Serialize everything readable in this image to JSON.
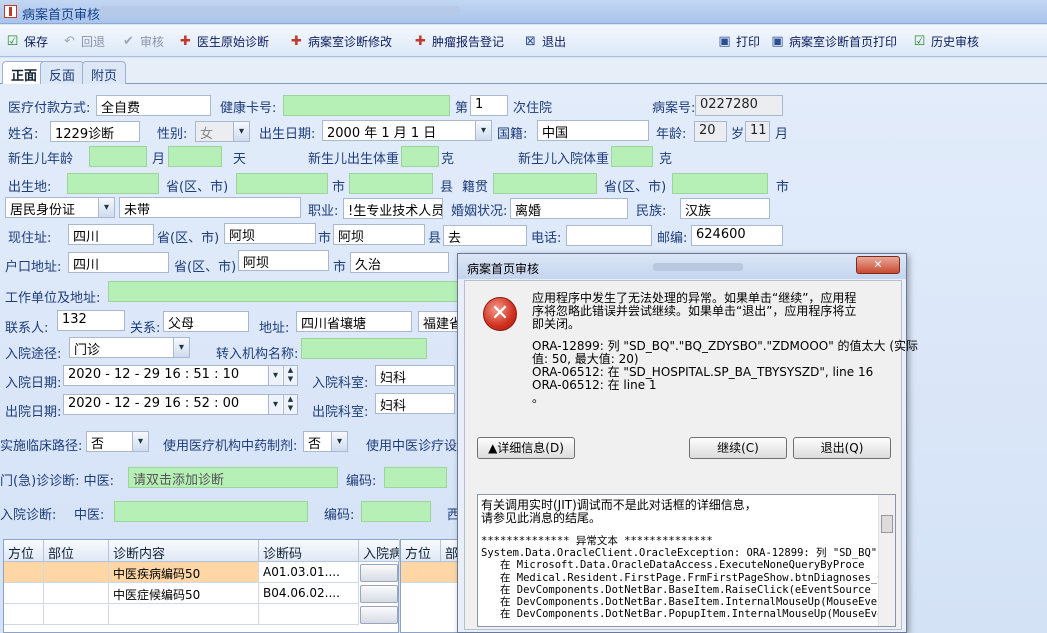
{
  "window": {
    "title": "病案首页审核"
  },
  "toolbar": {
    "save": "保存",
    "rollback": "回退",
    "review": "审核",
    "doctor_diag": "医生原始诊断",
    "room_diag_edit": "病案室诊断修改",
    "tumor_report": "肿瘤报告登记",
    "exit": "退出",
    "print": "打印",
    "room_print": "病案室诊断首页打印",
    "history": "历史审核"
  },
  "tabs": [
    "正面",
    "反面",
    "附页"
  ],
  "form": {
    "pay_label": "医疗付款方式:",
    "pay_value": "全自费",
    "health_card_label": "健康卡号:",
    "health_card_value": "",
    "visit_prefix": "第",
    "visit_value": "1",
    "visit_suffix": "次住院",
    "case_no_label": "病案号:",
    "case_no_value": "0227280",
    "name_label": "姓名:",
    "name_value": "1229诊断",
    "gender_label": "性别:",
    "gender_value": "女",
    "dob_label": "出生日期:",
    "dob_value": "2000 年 1 月 1 日",
    "nationality_label": "国籍:",
    "nationality_value": "中国",
    "age_label": "年龄:",
    "age_value": "20",
    "age_unit": "岁",
    "age_month": "11",
    "month_unit": "月",
    "newborn_age": "新生儿年龄",
    "month": "月",
    "day": "天",
    "newborn_birth_weight": "新生儿出生体重",
    "gram": "克",
    "newborn_admit_weight": "新生儿入院体重",
    "gram2": "克",
    "birthplace_label": "出生地:",
    "prov": "省(区、市)",
    "city": "市",
    "county": "县",
    "native_label": "籍贯",
    "prov2": "省(区、市)",
    "city2": "市",
    "id_type": "居民身份证",
    "id_value": "未带",
    "job_label": "职业:",
    "job_value": "!生专业技术人员",
    "marital_label": "婚姻状况:",
    "marital_value": "离婚",
    "ethnic_label": "民族:",
    "ethnic_value": "汉族",
    "cur_addr_label": "现住址:",
    "cur_prov": "四川",
    "cur_prov_unit": "省(区、市)",
    "cur_city": "阿坝",
    "cur_city_unit": "市",
    "cur_county": "阿坝",
    "cur_county_unit": "县",
    "cur_detail": "去",
    "phone_label": "电话:",
    "zip_label": "邮编:",
    "zip_value": "624600",
    "reg_addr_label": "户口地址:",
    "reg_prov": "四川",
    "reg_prov_unit": "省(区、市)",
    "reg_city": "阿坝",
    "reg_city_unit": "市",
    "reg_county": "久治",
    "work_label": "工作单位及地址:",
    "contact_label": "联系人:",
    "contact_value": "132",
    "relation_label": "关系:",
    "relation_value": "父母",
    "address_label": "地址:",
    "address_value": "四川省壤塘",
    "address_value2": "福建省",
    "route_label": "入院途径:",
    "route_value": "门诊",
    "transfer_label": "转入机构名称:",
    "admit_date_label": "入院日期:",
    "admit_date_value": "2020 - 12 - 29   16 : 51 : 10",
    "admit_dept_label": "入院科室:",
    "admit_dept_value": "妇科",
    "discharge_date_label": "出院日期:",
    "discharge_date_value": "2020 - 12 - 29   16 : 52 : 00",
    "discharge_dept_label": "出院科室:",
    "discharge_dept_value": "妇科",
    "pathway_label": "实施临床路径:",
    "pathway_value": "否",
    "tcm_prep_label": "使用医疗机构中药制剂:",
    "tcm_prep_value": "否",
    "tcm_device_label": "使用中医诊疗设",
    "er_diag_label": "门(急)诊诊断: 中医:",
    "er_diag_placeholder": "请双击添加诊断",
    "code_label": "编码:",
    "admit_diag_label": "入院诊断:",
    "tcm_label": "中医:",
    "code_label2": "编码:",
    "west_label": "西"
  },
  "diag_table": {
    "headers": [
      "方位",
      "部位",
      "诊断内容",
      "诊断码",
      "入院病"
    ],
    "rows": [
      {
        "content": "中医疾病编码50",
        "code": "A01.03.01...."
      },
      {
        "content": "中医症候编码50",
        "code": "B04.06.02...."
      }
    ],
    "right_headers": [
      "方位",
      "部"
    ]
  },
  "dialog": {
    "title": "病案首页审核",
    "close": "✕",
    "message": "应用程序中发生了无法处理的异常。如果单击“继续”，应用程\n序将忽略此错误并尝试继续。如果单击“退出”，应用程序将立\n即关闭。",
    "error": "ORA-12899: 列 \"SD_BQ\".\"BQ_ZDYSBO\".\"ZDMOOO\" 的值太大 (实际\n值: 50, 最大值: 20)\nORA-06512: 在 \"SD_HOSPITAL.SP_BA_TBYSYSZD\", line 16\nORA-06512: 在 line 1\n。",
    "details_btn": "▲详细信息(D)",
    "continue_btn": "继续(C)",
    "exit_btn": "退出(Q)",
    "detail_text": "有关调用实时(JIT)调试而不是此对话框的详细信息，\n请参见此消息的结尾。",
    "stack": "************** 异常文本 **************\nSystem.Data.OracleClient.OracleException: ORA-12899: 列 \"SD_BQ\".\"B\n   在 Microsoft.Data.OracleDataAccess.ExecuteNoneQueryByProce\n   在 Medical.Resident.FirstPage.FrmFirstPageShow.btnDiagnoses_Cli\n   在 DevComponents.DotNetBar.BaseItem.RaiseClick(eEventSource sou\n   在 DevComponents.DotNetBar.BaseItem.InternalMouseUp(MouseEventA\n   在 DevComponents.DotNetBar.PopupItem.InternalMouseUp(MouseEvent"
  }
}
